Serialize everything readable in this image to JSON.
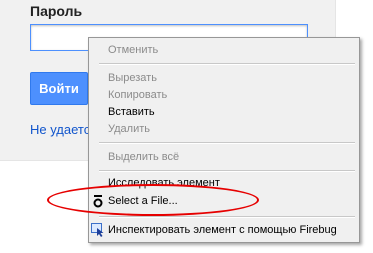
{
  "login": {
    "password_label": "Пароль",
    "password_value": "",
    "submit_label": "Войти",
    "forgot_link": "Не удается"
  },
  "context_menu": {
    "items": [
      {
        "label": "Отменить",
        "enabled": false
      },
      {
        "label": "Вырезать",
        "enabled": false
      },
      {
        "label": "Копировать",
        "enabled": false
      },
      {
        "label": "Вставить",
        "enabled": true
      },
      {
        "label": "Удалить",
        "enabled": false
      },
      {
        "label": "Выделить всё",
        "enabled": false
      },
      {
        "label": "Исследовать элемент",
        "enabled": true
      },
      {
        "label": "Select a File...",
        "enabled": true,
        "icon": "file-picker-icon"
      },
      {
        "label": "Инспектировать элемент с помощью Firebug",
        "enabled": true,
        "icon": "firebug-inspect-icon"
      }
    ]
  },
  "annotation": {
    "color": "#e60000"
  }
}
